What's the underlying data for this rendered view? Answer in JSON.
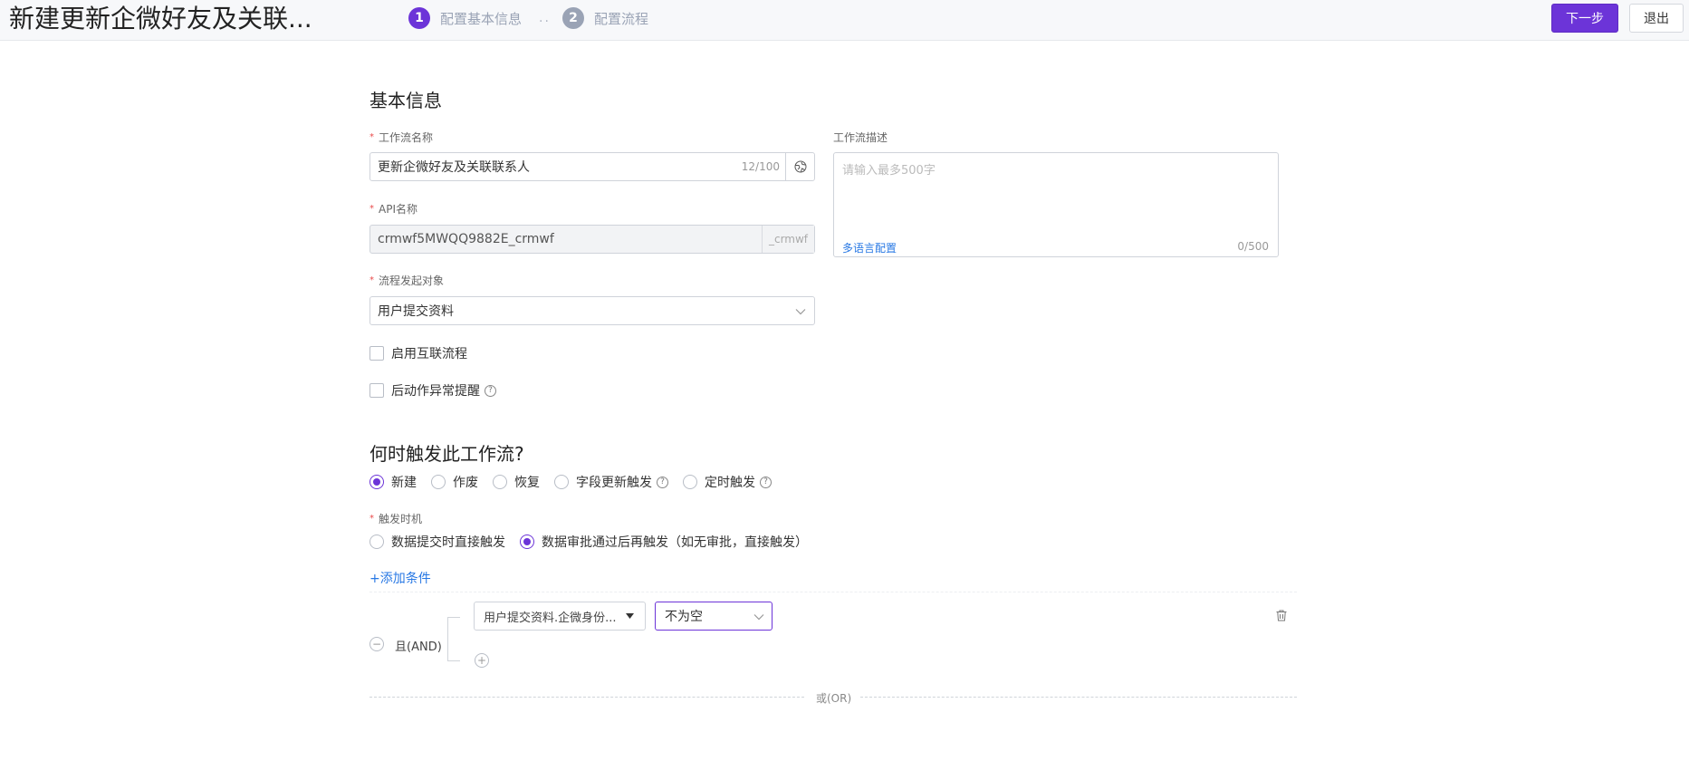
{
  "header": {
    "title": "新建更新企微好友及关联...",
    "steps": [
      {
        "num": "1",
        "label": "配置基本信息",
        "color": "#6c34d8"
      },
      {
        "num": "2",
        "label": "配置流程",
        "color": "#9aa3b5"
      }
    ],
    "step_separator": "..",
    "next_button": "下一步",
    "exit_button": "退出"
  },
  "basic_info": {
    "section_title": "基本信息",
    "workflow_name": {
      "label": "工作流名称",
      "value": "更新企微好友及关联联系人",
      "counter": "12/100",
      "addon_icon": "globe-icon"
    },
    "api_name": {
      "label": "API名称",
      "value": "crmwf5MWQQ9882E_crmwf",
      "suffix": "_crmwf"
    },
    "trigger_object": {
      "label": "流程发起对象",
      "value": "用户提交资料"
    },
    "description": {
      "label": "工作流描述",
      "placeholder": "请输入最多500字",
      "multi_lang_link": "多语言配置",
      "counter": "0/500"
    },
    "checkboxes": [
      {
        "label": "启用互联流程",
        "checked": false,
        "help": false
      },
      {
        "label": "后动作异常提醒",
        "checked": false,
        "help": true
      }
    ]
  },
  "trigger": {
    "section_title": "何时触发此工作流?",
    "types": [
      {
        "label": "新建",
        "selected": true,
        "help": false
      },
      {
        "label": "作废",
        "selected": false,
        "help": false
      },
      {
        "label": "恢复",
        "selected": false,
        "help": false
      },
      {
        "label": "字段更新触发",
        "selected": false,
        "help": true
      },
      {
        "label": "定时触发",
        "selected": false,
        "help": true
      }
    ],
    "timing": {
      "label": "触发时机",
      "options": [
        {
          "label": "数据提交时直接触发",
          "selected": false
        },
        {
          "label": "数据审批通过后再触发（如无审批，直接触发）",
          "selected": true
        }
      ]
    },
    "add_condition": "+添加条件",
    "condition_group": {
      "logic_label": "且(AND)",
      "field": "用户提交资料.企微身份...",
      "operator": "不为空"
    },
    "or_label": "或(OR)"
  },
  "colors": {
    "accent": "#6c34d8",
    "link": "#2878e4",
    "required": "#e94b4b"
  }
}
